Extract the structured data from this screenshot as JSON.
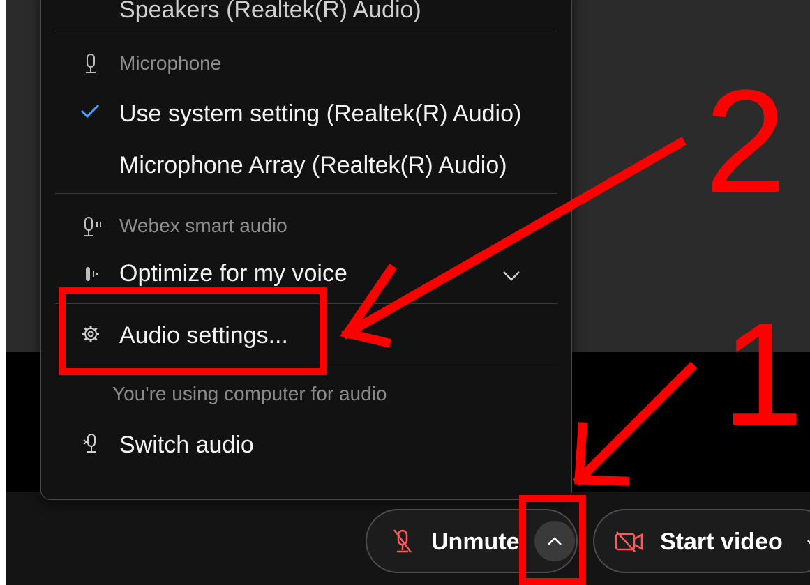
{
  "menu": {
    "speaker_item": "Speakers (Realtek(R) Audio)",
    "microphone_header": "Microphone",
    "mic_options": [
      {
        "label": "Use system setting (Realtek(R) Audio)",
        "selected": true
      },
      {
        "label": "Microphone Array (Realtek(R) Audio)",
        "selected": false
      }
    ],
    "smart_audio_header": "Webex smart audio",
    "optimize_label": "Optimize for my voice",
    "audio_settings_label": "Audio settings...",
    "status_text": "You're using computer for audio",
    "switch_audio_label": "Switch audio"
  },
  "controls": {
    "unmute_label": "Unmute",
    "start_video_label": "Start video"
  },
  "annotations": {
    "step1": "1",
    "step2": "2",
    "color": "#ff0000"
  },
  "colors": {
    "check": "#4aa3ff",
    "mute_icon": "#ff5a5a",
    "video_icon": "#ff5a5a"
  }
}
